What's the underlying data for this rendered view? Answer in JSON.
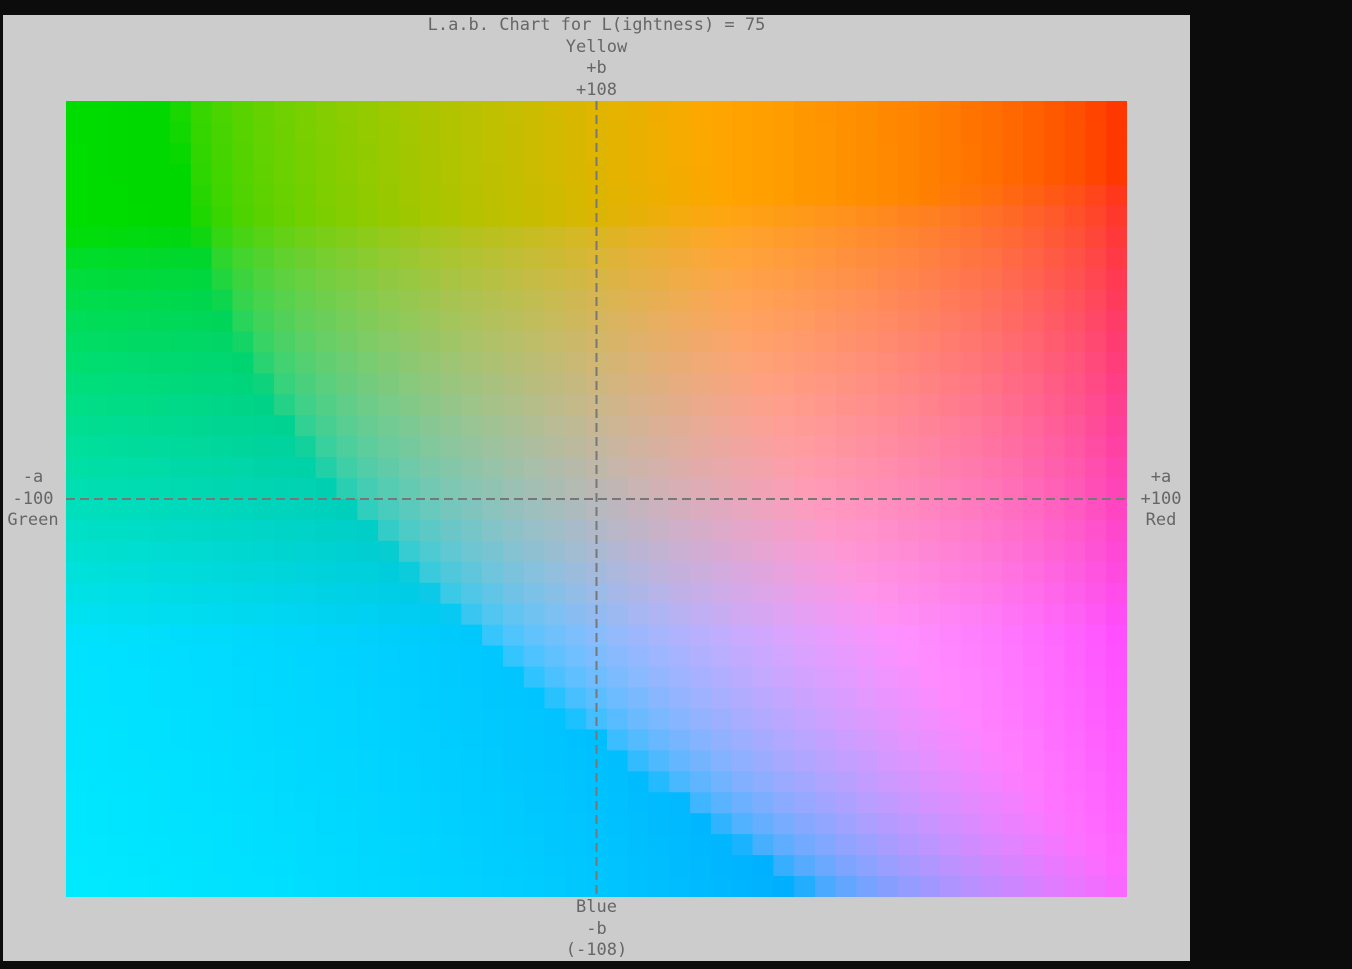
{
  "chart": {
    "title": "L.a.b. Chart for L(ightness) = 75",
    "top_label": "Yellow",
    "top_sign": "+b",
    "top_value": "+108",
    "bottom_label": "Blue",
    "bottom_sign": "-b",
    "bottom_value": "(-108)",
    "left_sign": "-a",
    "left_value": "-100",
    "left_label": "Green",
    "right_sign": "+a",
    "right_value": "+100",
    "right_label": "Red"
  },
  "chart_data": {
    "type": "heatmap",
    "title": "L.a.b. Chart for L(ightness) = 75",
    "lightness": 75,
    "a_range": [
      -100,
      100
    ],
    "b_range": [
      -108,
      108
    ],
    "x_axis": {
      "negative": "Green",
      "positive": "Red"
    },
    "y_axis": {
      "negative": "Blue",
      "positive": "Yellow"
    },
    "grid_columns": 51,
    "grid_rows": 38,
    "grid_lines": "dashed at a=0 and b=0"
  },
  "colors": {
    "terminal_background": "#0c0c0c",
    "panel_background": "#cccccc",
    "label_text": "#666666",
    "axis_lines": "#777777"
  }
}
